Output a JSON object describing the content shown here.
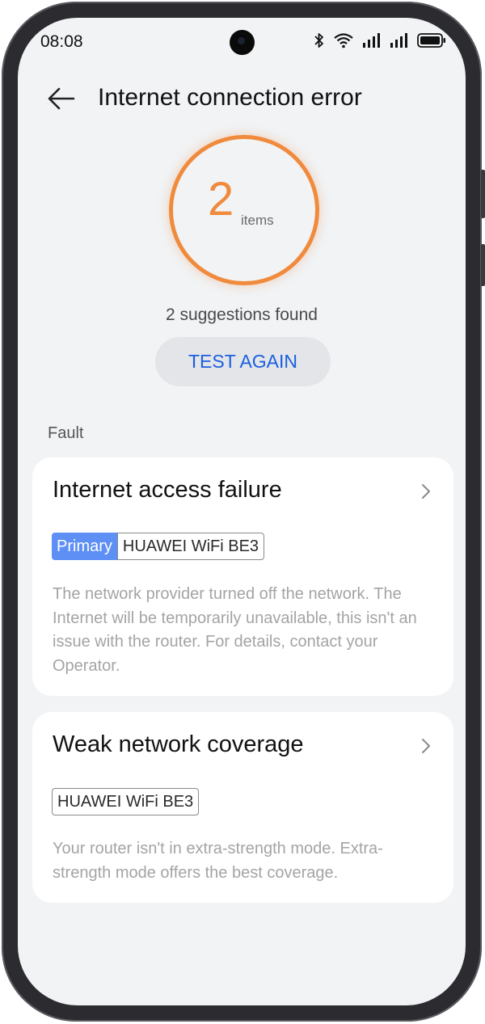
{
  "status_bar": {
    "time": "08:08",
    "icons": [
      "bluetooth-icon",
      "wifi-icon",
      "signal-icon",
      "signal-icon",
      "battery-icon"
    ]
  },
  "header": {
    "title": "Internet connection error",
    "back_icon": "back-arrow-icon"
  },
  "summary": {
    "count": "2",
    "unit": "items",
    "suggestions": "2 suggestions found",
    "ring_color": "#f08a3c"
  },
  "test_again_label": "TEST AGAIN",
  "section_label": "Fault",
  "faults": [
    {
      "title": "Internet access failure",
      "tag_primary": "Primary",
      "device": "HUAWEI WiFi BE3",
      "description": "The network provider turned off the network. The Internet will be temporarily unavailable, this isn't an issue with the router. For details, contact your Operator."
    },
    {
      "title": "Weak network coverage",
      "device": "HUAWEI WiFi BE3",
      "description": "Your router isn't in extra-strength mode. Extra-strength mode offers the best coverage."
    }
  ],
  "colors": {
    "accent": "#1b5fe0",
    "primary_tag": "#5d8ff5",
    "background": "#f1f3f5"
  }
}
